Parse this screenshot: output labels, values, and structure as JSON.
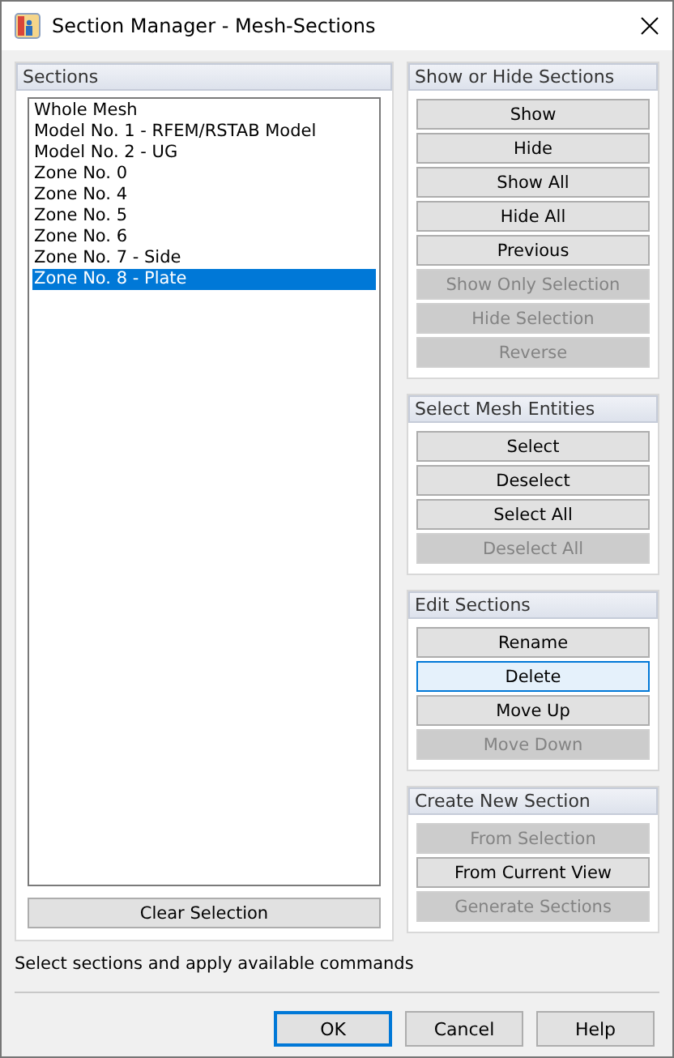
{
  "window": {
    "title": "Section Manager - Mesh-Sections"
  },
  "sections": {
    "title": "Sections",
    "items": [
      {
        "label": "Whole Mesh",
        "selected": false
      },
      {
        "label": "Model No. 1 - RFEM/RSTAB Model",
        "selected": false
      },
      {
        "label": "Model No. 2 - UG",
        "selected": false
      },
      {
        "label": "Zone No. 0",
        "selected": false
      },
      {
        "label": "Zone No. 4",
        "selected": false
      },
      {
        "label": "Zone No. 5",
        "selected": false
      },
      {
        "label": "Zone No. 6",
        "selected": false
      },
      {
        "label": "Zone No. 7 - Side",
        "selected": false
      },
      {
        "label": "Zone No. 8 - Plate",
        "selected": true
      }
    ],
    "button": "Clear Selection"
  },
  "groups": [
    {
      "title": "Show or Hide Sections",
      "buttons": [
        {
          "label": "Show",
          "disabled": false,
          "highlighted": false
        },
        {
          "label": "Hide",
          "disabled": false,
          "highlighted": false
        },
        {
          "label": "Show All",
          "disabled": false,
          "highlighted": false
        },
        {
          "label": "Hide All",
          "disabled": false,
          "highlighted": false
        },
        {
          "label": "Previous",
          "disabled": false,
          "highlighted": false
        },
        {
          "label": "Show Only Selection",
          "disabled": true,
          "highlighted": false
        },
        {
          "label": "Hide Selection",
          "disabled": true,
          "highlighted": false
        },
        {
          "label": "Reverse",
          "disabled": true,
          "highlighted": false
        }
      ]
    },
    {
      "title": "Select Mesh Entities",
      "buttons": [
        {
          "label": "Select",
          "disabled": false,
          "highlighted": false
        },
        {
          "label": "Deselect",
          "disabled": false,
          "highlighted": false
        },
        {
          "label": "Select All",
          "disabled": false,
          "highlighted": false
        },
        {
          "label": "Deselect All",
          "disabled": true,
          "highlighted": false
        }
      ]
    },
    {
      "title": "Edit Sections",
      "buttons": [
        {
          "label": "Rename",
          "disabled": false,
          "highlighted": false
        },
        {
          "label": "Delete",
          "disabled": false,
          "highlighted": true
        },
        {
          "label": "Move Up",
          "disabled": false,
          "highlighted": false
        },
        {
          "label": "Move Down",
          "disabled": true,
          "highlighted": false
        }
      ]
    },
    {
      "title": "Create New Section",
      "buttons": [
        {
          "label": "From Selection",
          "disabled": true,
          "highlighted": false
        },
        {
          "label": "From Current View",
          "disabled": false,
          "highlighted": false
        },
        {
          "label": "Generate Sections",
          "disabled": true,
          "highlighted": false
        }
      ]
    }
  ],
  "status": "Select sections and apply available commands",
  "dialog_buttons": [
    {
      "label": "OK",
      "default": true
    },
    {
      "label": "Cancel",
      "default": false
    },
    {
      "label": "Help",
      "default": false
    }
  ]
}
